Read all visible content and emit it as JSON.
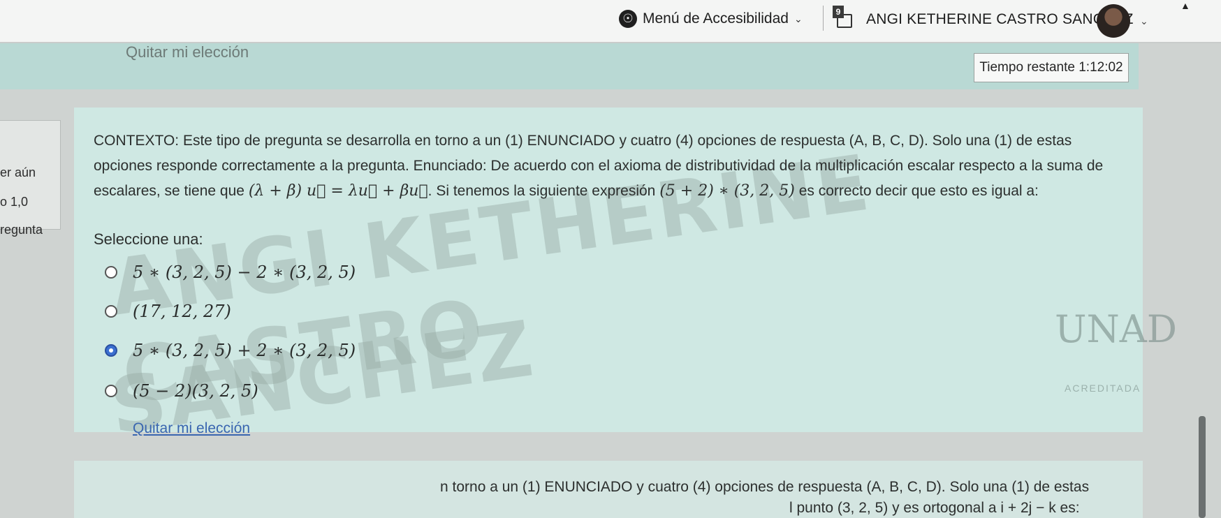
{
  "topbar": {
    "accessibility_label": "Menú de Accesibilidad",
    "notification_count": "9",
    "user_name": "ANGI KETHERINE CASTRO SANCHEZ"
  },
  "band": {
    "ghost_text": "Quitar mi elección",
    "timer": "Tiempo restante 1:12:02"
  },
  "left_panel": {
    "line1": "er aún",
    "line2": "o 1,0",
    "line3": "regunta"
  },
  "question": {
    "text_part1": "CONTEXTO: Este tipo de pregunta se desarrolla en torno a un (1) ENUNCIADO y cuatro (4) opciones de respuesta (A, B, C, D). Solo una (1) de estas opciones responde correctamente a la pregunta. Enunciado: De acuerdo con el axioma de distributividad de la multiplicación escalar respecto a la suma de escalares, se tiene que",
    "formula": "(λ + β) u⃗ = λu⃗ + βu⃗",
    "text_part2": ". Si tenemos la siguiente expresión",
    "expression": "(5 + 2) ∗ (3, 2, 5)",
    "text_part3": "es correcto decir que esto es igual a:",
    "select_label": "Seleccione una:",
    "options": [
      {
        "text": "5 ∗ (3, 2, 5) − 2 ∗ (3, 2, 5)",
        "selected": false
      },
      {
        "text": "(17, 12, 27)",
        "selected": false
      },
      {
        "text": "5 ∗ (3, 2, 5) + 2 ∗ (3, 2, 5)",
        "selected": true
      },
      {
        "text": "(5 − 2)(3, 2, 5)",
        "selected": false
      }
    ],
    "clear_label": "Quitar mi elección"
  },
  "watermark": {
    "line1": "ANGI KETHERINE CASTRO",
    "line2": "SANCHEZ"
  },
  "logo": {
    "name": "UNAD",
    "badge": "ACREDITADA"
  },
  "next_question": {
    "line1": "n torno a un (1) ENUNCIADO y cuatro (4) opciones de respuesta (A, B, C, D). Solo una (1) de estas",
    "line2": "l punto (3, 2, 5) y es ortogonal a i + 2j − k es:"
  }
}
